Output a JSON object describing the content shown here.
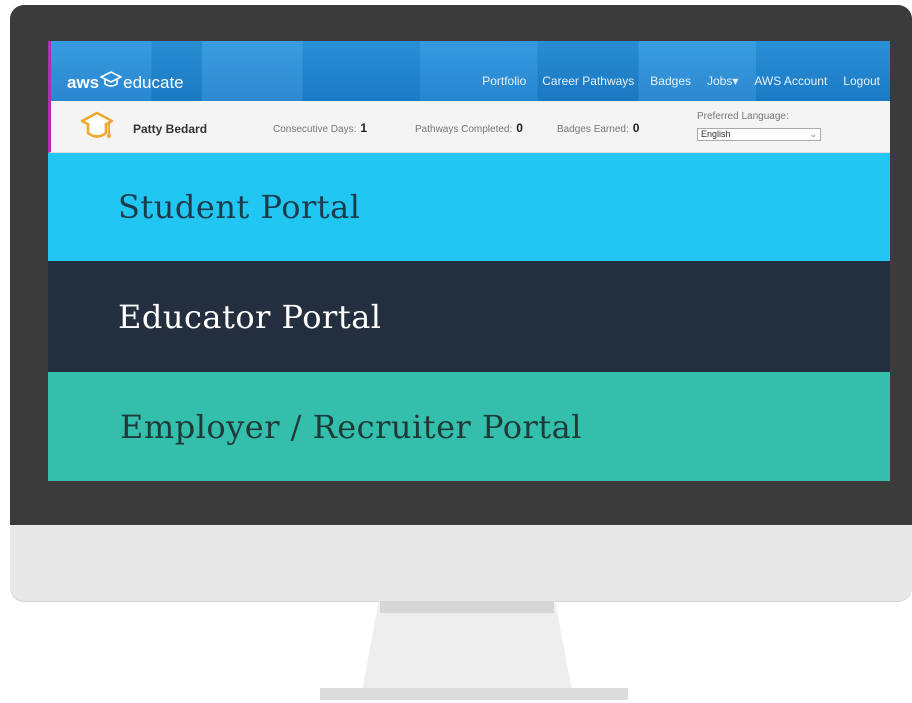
{
  "header": {
    "logo_aws": "aws",
    "logo_educate": "educate",
    "nav": [
      "Portfolio",
      "Career Pathways",
      "Badges",
      "Jobs▾",
      "AWS Account",
      "Logout"
    ]
  },
  "profile": {
    "name": "Patty Bedard",
    "consecutive_days_label": "Consecutive Days:",
    "consecutive_days": "1",
    "pathways_label": "Pathways Completed:",
    "pathways": "0",
    "badges_label": "Badges Earned:",
    "badges": "0",
    "language_label": "Preferred Language:",
    "language_value": "English"
  },
  "portals": {
    "student": "Student Portal",
    "educator": "Educator Portal",
    "employer": "Employer / Recruiter Portal"
  },
  "colors": {
    "student": "#21c6f2",
    "educator": "#232f3e",
    "employer": "#33bfac",
    "topbar": "#1f86d2"
  },
  "icons": [
    "graduation-cap-icon",
    "chevron-down-icon"
  ]
}
